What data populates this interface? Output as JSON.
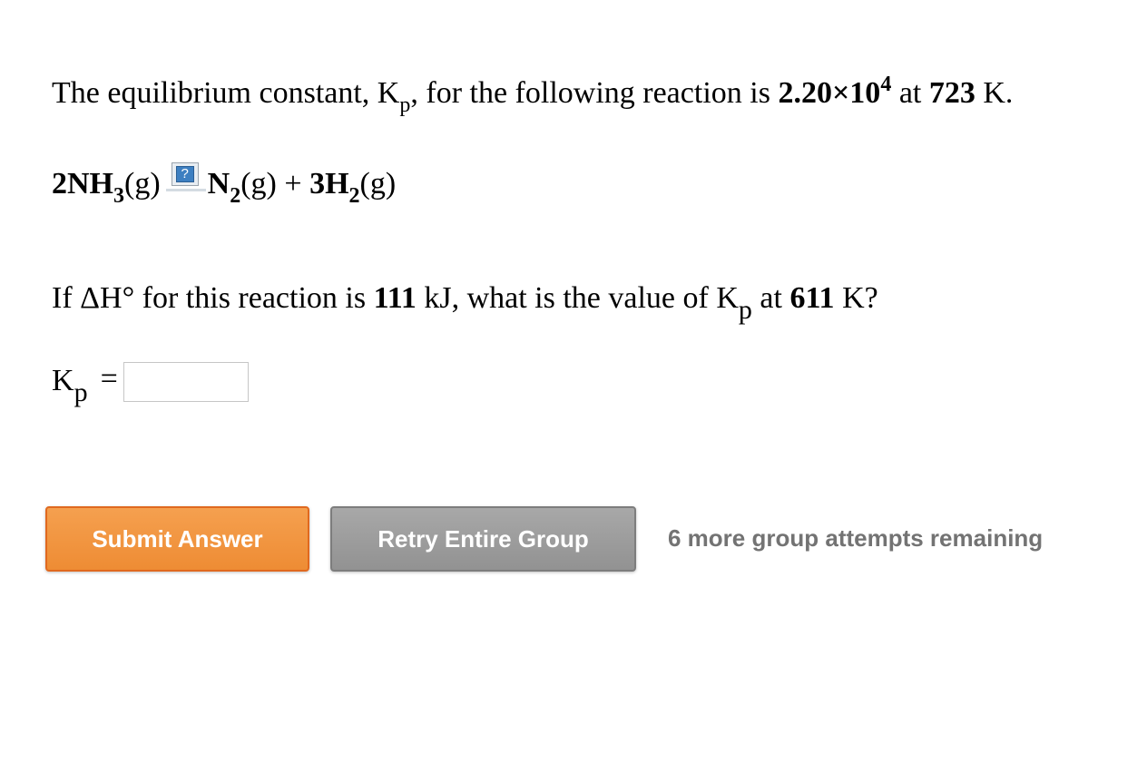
{
  "intro": {
    "prefix": "The equilibrium constant, K",
    "kp_sub": "p",
    "middle": ", for the following reaction is ",
    "k_mantissa": "2.20×10",
    "k_exponent": "4",
    "at_text": " at ",
    "temperature": "723",
    "temperature_unit": " K."
  },
  "reaction": {
    "reactant_coeff_formula": "2NH",
    "reactant_sub": "3",
    "reactant_state": "(g)",
    "arrow_icon": "help-question-icon",
    "arrow_icon_glyph": "?",
    "product1_formula": "N",
    "product1_sub": "2",
    "product1_state": "(g)",
    "plus": " + ",
    "product2_formula": "3H",
    "product2_sub": "2",
    "product2_state": "(g)"
  },
  "question": {
    "prefix": "If ΔH° for this reaction is ",
    "dh_value": "111",
    "dh_unit": " kJ, what is the value of K",
    "kp_sub": "p",
    "at_text": " at ",
    "temperature": "611",
    "temperature_unit": " K?"
  },
  "answer": {
    "label": "K",
    "label_sub": "p",
    "equals": "=",
    "value": "",
    "placeholder": ""
  },
  "actions": {
    "submit_label": "Submit Answer",
    "retry_label": "Retry Entire Group",
    "attempts_text": "6 more group attempts remaining"
  },
  "colors": {
    "submit_bg": "#ee8c34",
    "retry_bg": "#929292",
    "attempts_text": "#737373",
    "help_icon_bg": "#3d7fc1"
  }
}
